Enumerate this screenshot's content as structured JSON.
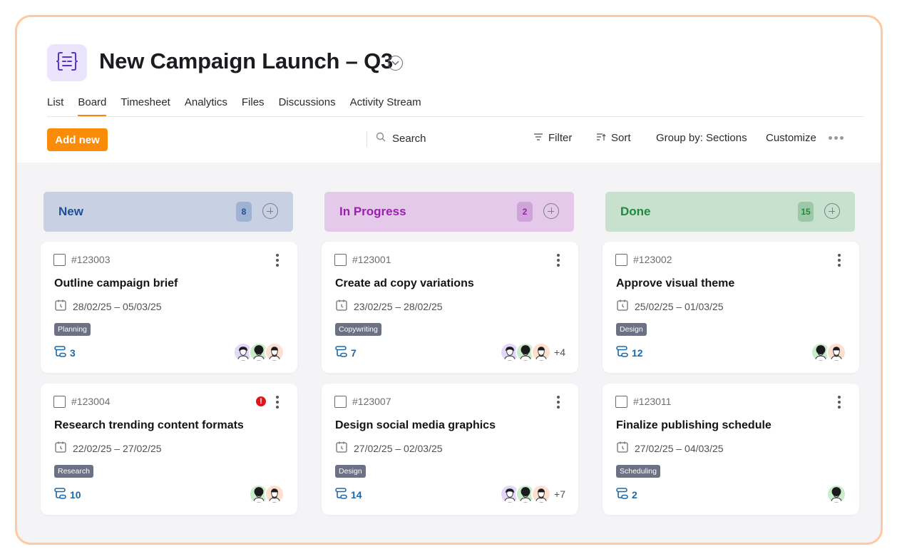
{
  "project": {
    "title": "New Campaign Launch – Q3",
    "logo_icon": "brackets-list-icon"
  },
  "tabs": [
    {
      "label": "List",
      "active": false
    },
    {
      "label": "Board",
      "active": true
    },
    {
      "label": "Timesheet",
      "active": false
    },
    {
      "label": "Analytics",
      "active": false
    },
    {
      "label": "Files",
      "active": false
    },
    {
      "label": "Discussions",
      "active": false
    },
    {
      "label": "Activity Stream",
      "active": false
    }
  ],
  "toolbar": {
    "add_label": "Add new",
    "search_placeholder": "Search",
    "filter_label": "Filter",
    "sort_label": "Sort",
    "group_label": "Group by: Sections",
    "customize_label": "Customize"
  },
  "colors": {
    "accent": "#fb8c0a",
    "new_header": "#c7d1e3",
    "new_text": "#1d4f9a",
    "new_badge": "#9fb2d3",
    "progress_header": "#e5c9ea",
    "progress_text": "#9b1fb0",
    "progress_badge": "#cfa4d8",
    "done_header": "#c6e1cd",
    "done_text": "#1f8a3a",
    "done_badge": "#9cc8a9",
    "tag": "#6c7184",
    "subtask": "#1b68a8"
  },
  "columns": [
    {
      "name": "New",
      "count": "8",
      "cards": [
        {
          "id": "#123003",
          "title": "Outline campaign brief",
          "dates": "28/02/25 – 05/03/25",
          "tag": "Planning",
          "subtasks": "3",
          "alert": false,
          "avatars": [
            "purple",
            "green",
            "peach"
          ],
          "more": ""
        },
        {
          "id": "#123004",
          "title": "Research trending content formats",
          "dates": "22/02/25 – 27/02/25",
          "tag": "Research",
          "subtasks": "10",
          "alert": true,
          "avatars": [
            "green",
            "peach"
          ],
          "more": ""
        }
      ]
    },
    {
      "name": "In Progress",
      "count": "2",
      "cards": [
        {
          "id": "#123001",
          "title": "Create ad copy variations",
          "dates": "23/02/25 – 28/02/25",
          "tag": "Copywriting",
          "subtasks": "7",
          "alert": false,
          "avatars": [
            "purple",
            "green",
            "peach"
          ],
          "more": "+4"
        },
        {
          "id": "#123007",
          "title": "Design social media graphics",
          "dates": "27/02/25 – 02/03/25",
          "tag": "Design",
          "subtasks": "14",
          "alert": false,
          "avatars": [
            "purple",
            "green",
            "peach"
          ],
          "more": "+7"
        }
      ]
    },
    {
      "name": "Done",
      "count": "15",
      "cards": [
        {
          "id": "#123002",
          "title": "Approve visual theme",
          "dates": "25/02/25 – 01/03/25",
          "tag": "Design",
          "subtasks": "12",
          "alert": false,
          "avatars": [
            "green",
            "peach"
          ],
          "more": ""
        },
        {
          "id": "#123011",
          "title": "Finalize publishing schedule",
          "dates": "27/02/25 – 04/03/25",
          "tag": "Scheduling",
          "subtasks": "2",
          "alert": false,
          "avatars": [
            "green"
          ],
          "more": ""
        }
      ]
    }
  ]
}
